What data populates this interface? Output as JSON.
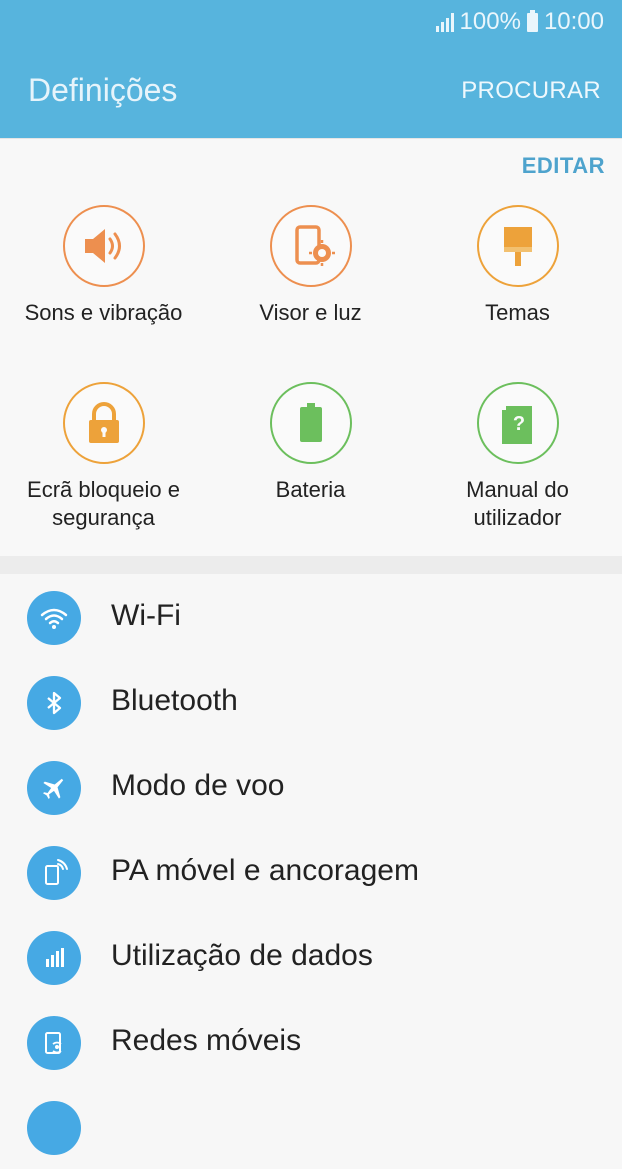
{
  "status_bar": {
    "battery": "100%",
    "time": "10:00"
  },
  "header": {
    "title": "Definições",
    "search_label": "PROCURAR"
  },
  "quick": {
    "edit_label": "EDITAR",
    "tiles": [
      {
        "label": "Sons e vibração",
        "icon": "speaker-icon",
        "color": "#ed8f4f"
      },
      {
        "label": "Visor e luz",
        "icon": "display-brightness-icon",
        "color": "#ed8f4f"
      },
      {
        "label": "Temas",
        "icon": "paintbrush-icon",
        "color": "#eda23a"
      },
      {
        "label": "Ecrã bloqueio e segurança",
        "icon": "lock-icon",
        "color": "#eda23a"
      },
      {
        "label": "Bateria",
        "icon": "battery-icon",
        "color": "#6cbf5d"
      },
      {
        "label": "Manual do utilizador",
        "icon": "help-book-icon",
        "color": "#6cbf5d"
      }
    ]
  },
  "settings_list": [
    {
      "label": "Wi-Fi",
      "icon": "wifi-icon"
    },
    {
      "label": "Bluetooth",
      "icon": "bluetooth-icon"
    },
    {
      "label": "Modo de voo",
      "icon": "airplane-icon"
    },
    {
      "label": "PA móvel e ancoragem",
      "icon": "hotspot-icon"
    },
    {
      "label": "Utilização de dados",
      "icon": "data-usage-icon"
    },
    {
      "label": "Redes móveis",
      "icon": "mobile-network-icon"
    }
  ],
  "colors": {
    "header": "#57b4dd",
    "accent": "#4ea3cd",
    "list_icon": "#46a9e4"
  }
}
